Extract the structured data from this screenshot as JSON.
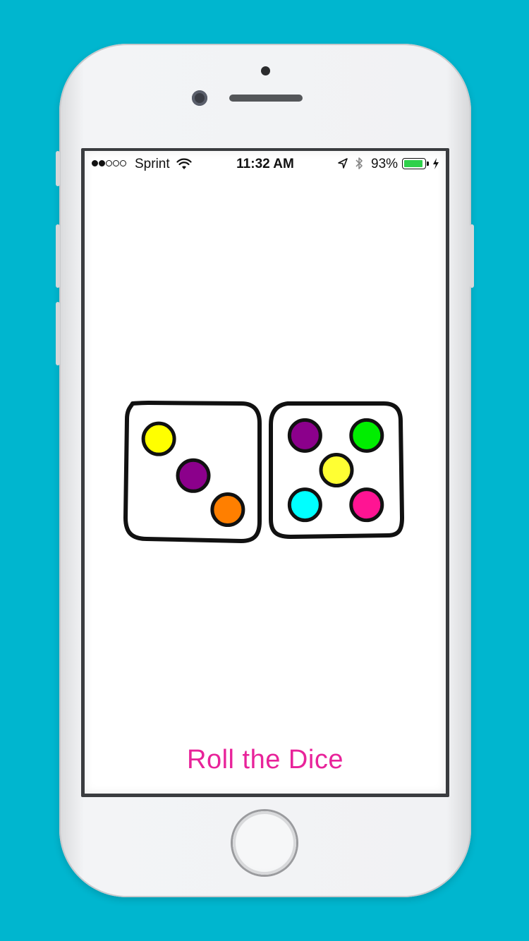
{
  "status_bar": {
    "signal_bars": 5,
    "signal_filled": 2,
    "carrier": "Sprint",
    "time": "11:32 AM",
    "battery_percent": "93%",
    "battery_level": 0.93,
    "battery_color": "#2fd14b"
  },
  "dice": [
    {
      "value": 3,
      "pip_colors": [
        "#ffff00",
        "#8b008b",
        "#ff7f00"
      ]
    },
    {
      "value": 5,
      "pip_colors": [
        "#8b008b",
        "#00ee00",
        "#ffff33",
        "#00ffff",
        "#ff1493"
      ]
    }
  ],
  "roll_button": {
    "label": "Roll the Dice",
    "color": "#e8239a"
  },
  "icons": [
    "wifi-icon",
    "location-arrow-icon",
    "bluetooth-icon",
    "battery-icon",
    "charging-bolt-icon"
  ]
}
